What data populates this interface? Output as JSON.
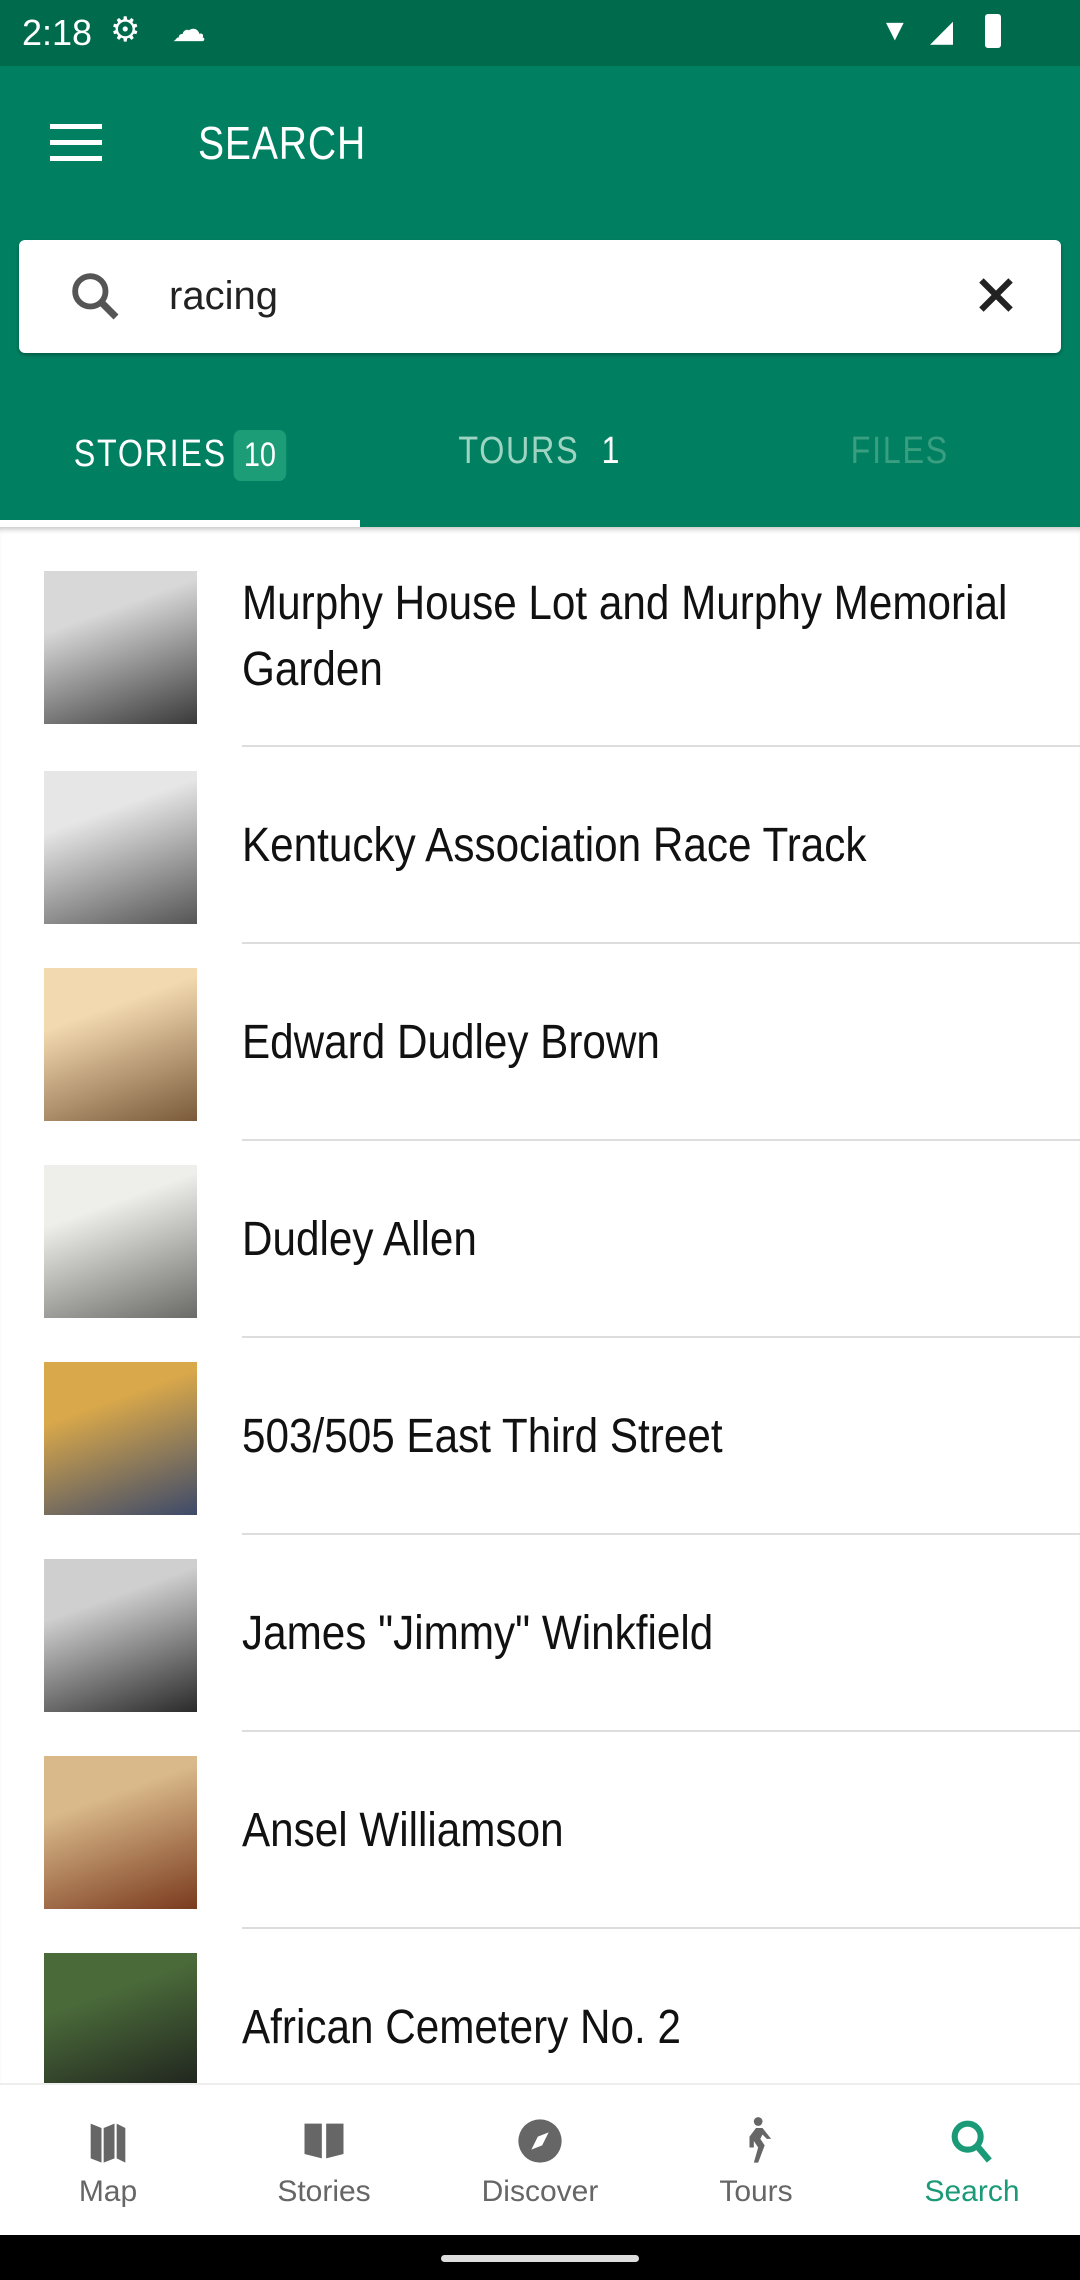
{
  "status": {
    "time": "2:18"
  },
  "header": {
    "title": "SEARCH"
  },
  "search": {
    "value": "racing",
    "placeholder": ""
  },
  "tabs": [
    {
      "label": "STORIES",
      "count": "10"
    },
    {
      "label": "TOURS",
      "count": "1"
    },
    {
      "label": "FILES",
      "count": ""
    }
  ],
  "results": [
    {
      "title": "Murphy House Lot and Murphy Memorial Garden",
      "thumb": [
        "#d8d8d8",
        "#3a3a3a"
      ]
    },
    {
      "title": "Kentucky Association Race Track",
      "thumb": [
        "#e6e6e6",
        "#555555"
      ]
    },
    {
      "title": "Edward Dudley Brown",
      "thumb": [
        "#f3d9b0",
        "#7a5a3a"
      ]
    },
    {
      "title": "Dudley Allen",
      "thumb": [
        "#eeeeea",
        "#6a6a66"
      ]
    },
    {
      "title": "503/505 East Third Street",
      "thumb": [
        "#d9a84a",
        "#3d4a6a"
      ]
    },
    {
      "title": "James \"Jimmy\" Winkfield",
      "thumb": [
        "#cfcfcf",
        "#2a2a2a"
      ]
    },
    {
      "title": "Ansel Williamson",
      "thumb": [
        "#d9b98a",
        "#7a3a1e"
      ]
    },
    {
      "title": "African Cemetery No. 2",
      "thumb": [
        "#4a6a3a",
        "#1a1a1a"
      ]
    }
  ],
  "nav": [
    {
      "label": "Map",
      "icon": "map-icon"
    },
    {
      "label": "Stories",
      "icon": "book-icon"
    },
    {
      "label": "Discover",
      "icon": "compass-icon"
    },
    {
      "label": "Tours",
      "icon": "walking-icon"
    },
    {
      "label": "Search",
      "icon": "search-icon"
    }
  ],
  "colors": {
    "primary": "#008061",
    "status": "#006b4c",
    "accent": "#1a9a76"
  }
}
